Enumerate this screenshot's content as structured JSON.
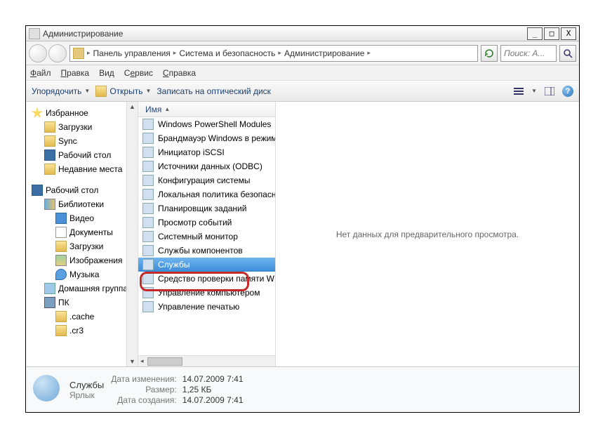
{
  "titlebar": {
    "title": "Администрирование"
  },
  "breadcrumb": {
    "items": [
      "Панель управления",
      "Система и безопасность",
      "Администрирование"
    ]
  },
  "search": {
    "placeholder": "Поиск: А..."
  },
  "menubar": {
    "file": "Файл",
    "edit": "Правка",
    "view": "Вид",
    "tools": "Сервис",
    "help": "Справка"
  },
  "toolbar": {
    "organize": "Упорядочить",
    "open": "Открыть",
    "burn": "Записать на оптический диск"
  },
  "nav": {
    "favorites": "Избранное",
    "fav_items": [
      "Загрузки",
      "Sync",
      "Рабочий стол",
      "Недавние места"
    ],
    "desktop": "Рабочий стол",
    "libraries": "Библиотеки",
    "lib_items": [
      "Видео",
      "Документы",
      "Загрузки",
      "Изображения",
      "Музыка"
    ],
    "homegroup": "Домашняя группа",
    "pc": "ПК",
    "pc_items": [
      ".cache",
      ".cr3"
    ]
  },
  "list": {
    "header": "Имя",
    "items": [
      "Windows PowerShell Modules",
      "Брандмауэр Windows в режим",
      "Инициатор iSCSI",
      "Источники данных (ODBC)",
      "Конфигурация системы",
      "Локальная политика безопасн",
      "Планировщик заданий",
      "Просмотр событий",
      "Системный монитор",
      "Службы компонентов",
      "Службы",
      "Средство проверки памяти W",
      "Управление компьютером",
      "Управление печатью"
    ],
    "selected_index": 10
  },
  "preview": {
    "empty_text": "Нет данных для предварительного просмотра."
  },
  "details": {
    "name": "Службы",
    "type": "Ярлык",
    "modified_label": "Дата изменения:",
    "modified": "14.07.2009 7:41",
    "size_label": "Размер:",
    "size": "1,25 КБ",
    "created_label": "Дата создания:",
    "created": "14.07.2009 7:41"
  }
}
